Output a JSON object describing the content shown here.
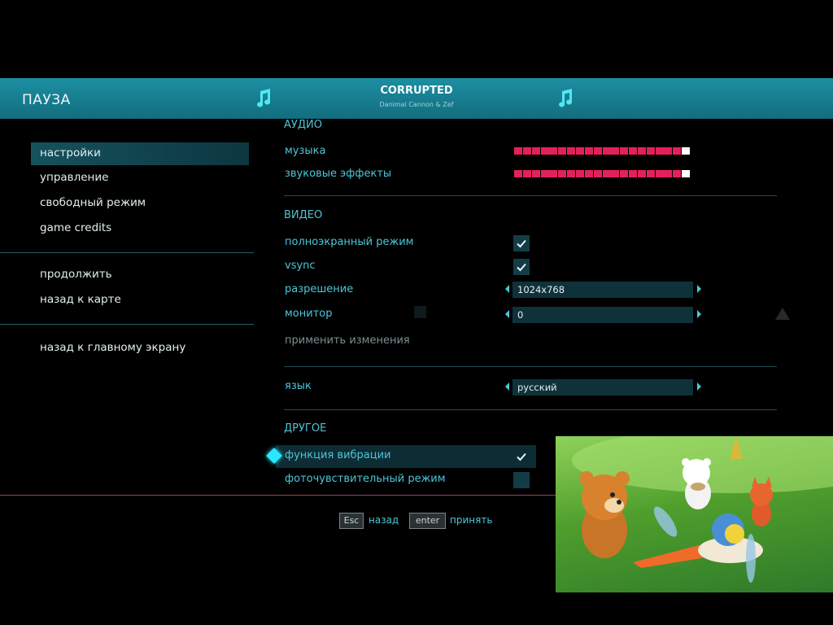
{
  "header": {
    "title": "ПАУЗА",
    "track_title": "CORRUPTED",
    "track_artist": "Danimal Cannon & Zef"
  },
  "menu": {
    "items": [
      {
        "label": "настройки",
        "selected": true
      },
      {
        "label": "управление"
      },
      {
        "label": "свободный режим"
      },
      {
        "label": "game credits"
      },
      {
        "label": "продолжить"
      },
      {
        "label": "назад к карте"
      },
      {
        "label": "назад к главному экрану"
      }
    ]
  },
  "settings": {
    "audio": {
      "heading": "АУДИО",
      "music_label": "музыка",
      "music_level": 1.0,
      "sfx_label": "звуковые эффекты",
      "sfx_level": 1.0
    },
    "video": {
      "heading": "ВИДЕО",
      "fullscreen_label": "полноэкранный режим",
      "fullscreen_checked": true,
      "vsync_label": "vsync",
      "vsync_checked": true,
      "resolution_label": "разрешение",
      "resolution_value": "1024x768",
      "monitor_label": "монитор",
      "monitor_value": "0",
      "apply_label": "применить изменения"
    },
    "language": {
      "label": "язык",
      "value": "русский"
    },
    "other": {
      "heading": "ДРУГОЕ",
      "vibration_label": "функция вибрации",
      "vibration_checked": true,
      "photosensitive_label": "фоточувствительный режим",
      "photosensitive_checked": false
    }
  },
  "footer": {
    "back_key": "Esc",
    "back_label": "назад",
    "accept_key": "enter",
    "accept_label": "принять"
  },
  "colors": {
    "accent": "#4cc6d8",
    "header": "#1a8597",
    "slider": "#e3205a"
  }
}
